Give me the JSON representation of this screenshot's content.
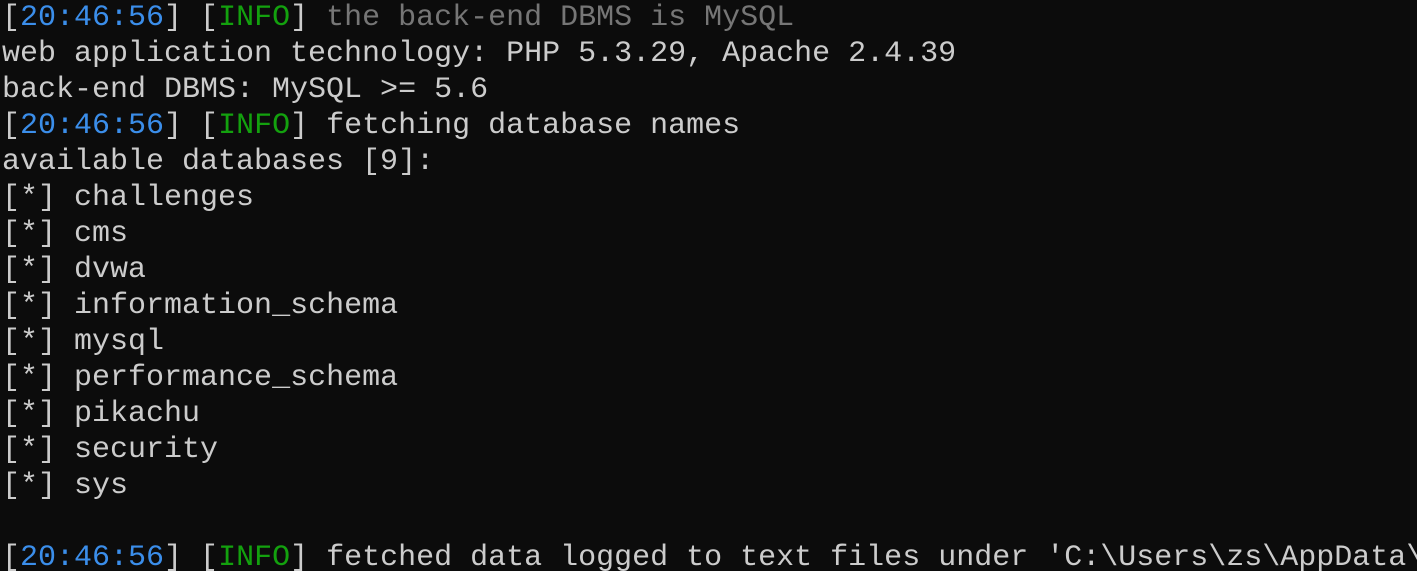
{
  "terminal": {
    "line1": {
      "ts": "20:46:56",
      "level": "INFO",
      "message": "the back-end DBMS is MySQL"
    },
    "line2": {
      "text": "web application technology: PHP 5.3.29, Apache 2.4.39"
    },
    "line3": {
      "text": "back-end DBMS: MySQL >= 5.6"
    },
    "line4": {
      "ts": "20:46:56",
      "level": "INFO",
      "message": "fetching database names"
    },
    "line5": {
      "text": "available databases [9]:"
    },
    "bullet": "[*]",
    "databases": [
      "challenges",
      "cms",
      "dvwa",
      "information_schema",
      "mysql",
      "performance_schema",
      "pikachu",
      "security",
      "sys"
    ],
    "line_last": {
      "ts": "20:46:56",
      "level": "INFO",
      "message": "fetched data logged to text files under 'C:\\Users\\zs\\AppData\\"
    }
  },
  "colors": {
    "background": "#0c0c0c",
    "text": "#cccccc",
    "timestamp": "#3b8eea",
    "info": "#13a10e",
    "dim": "#767676"
  }
}
